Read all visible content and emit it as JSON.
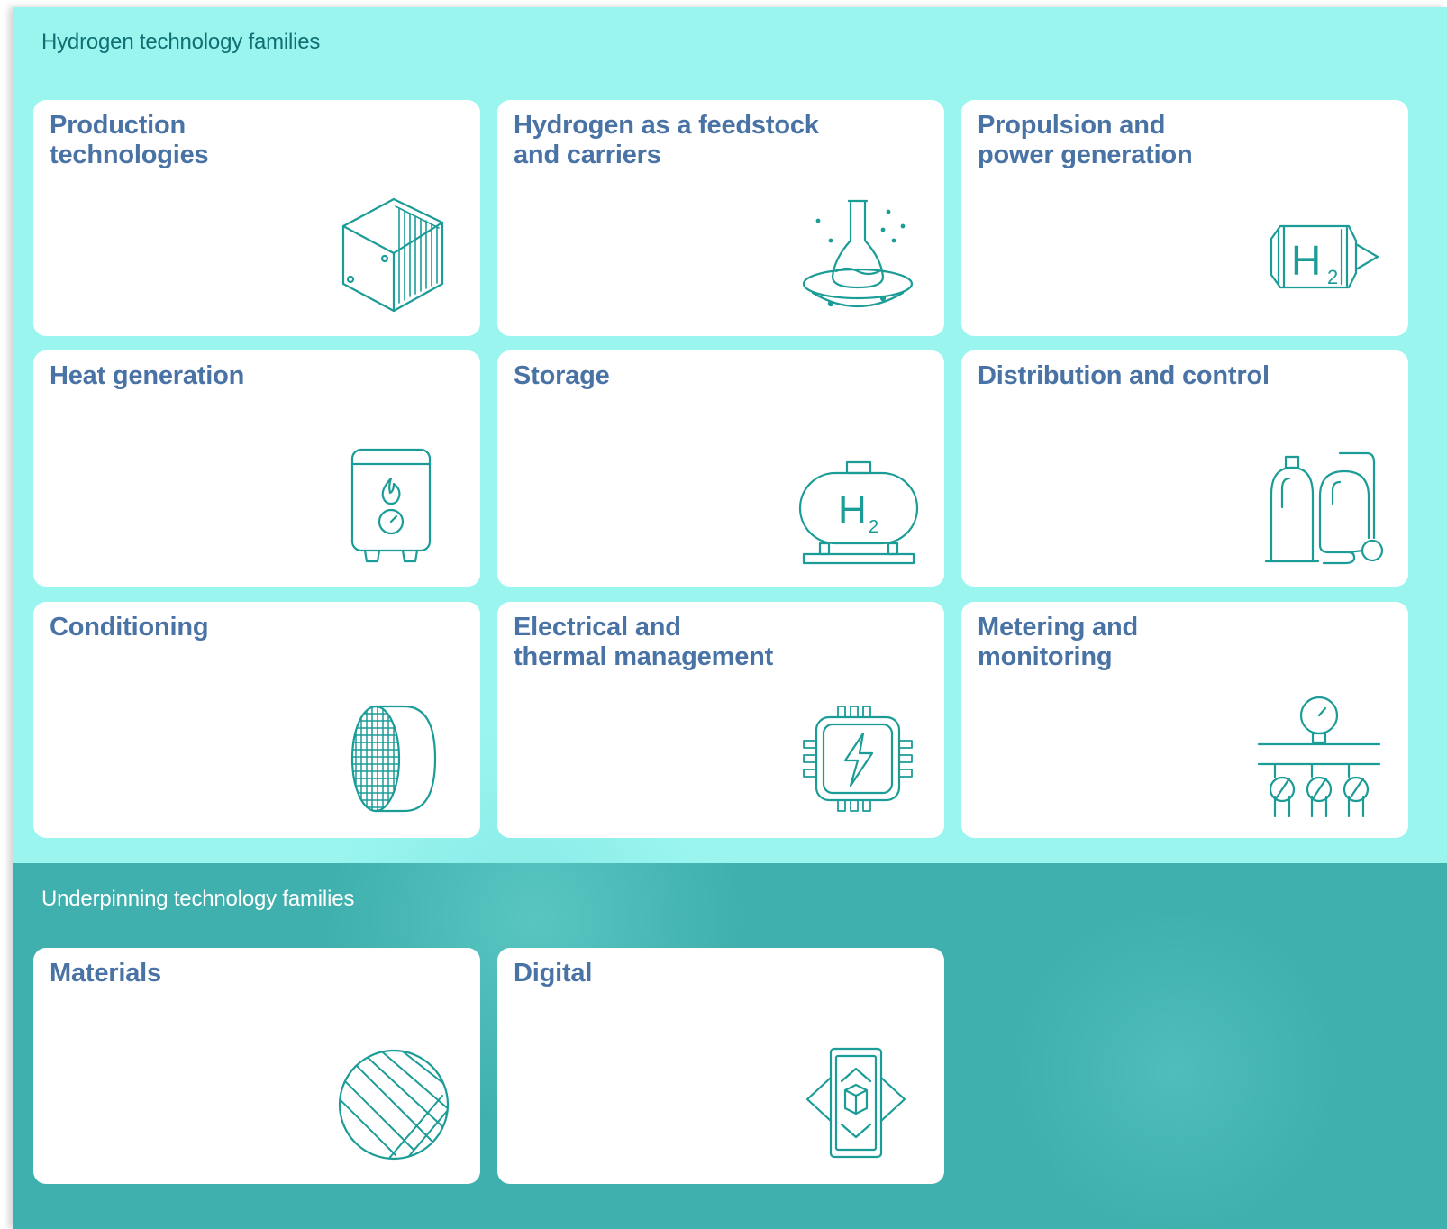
{
  "hydrogen_section": {
    "title": "Hydrogen technology families",
    "cards": [
      {
        "title": "Production\ntechnologies",
        "icon": "electrolyser-stack-icon"
      },
      {
        "title": "Hydrogen as a feedstock\nand carriers",
        "icon": "flask-icon"
      },
      {
        "title": "Propulsion and\npower generation",
        "icon": "h2-engine-icon"
      },
      {
        "title": "Heat generation",
        "icon": "boiler-icon"
      },
      {
        "title": "Storage",
        "icon": "h2-tank-icon"
      },
      {
        "title": "Distribution and control",
        "icon": "gas-cylinders-icon"
      },
      {
        "title": "Conditioning",
        "icon": "filter-cartridge-icon"
      },
      {
        "title": "Electrical and\nthermal management",
        "icon": "power-chip-icon"
      },
      {
        "title": "Metering and\nmonitoring",
        "icon": "pressure-gauge-manifold-icon"
      }
    ]
  },
  "underpinning_section": {
    "title": "Underpinning technology families",
    "cards": [
      {
        "title": "Materials",
        "icon": "material-sphere-icon"
      },
      {
        "title": "Digital",
        "icon": "digital-device-icon"
      }
    ]
  },
  "icon_symbols": {
    "h2_letter": "H",
    "h2_subscript": "2"
  },
  "colors": {
    "top_background": "#9af5ef",
    "bottom_background": "#3fb0ad",
    "card_title": "#4a73a5",
    "icon_stroke": "#1b9c97",
    "top_section_title": "#0f6f72",
    "bottom_section_title": "#ffffff"
  }
}
